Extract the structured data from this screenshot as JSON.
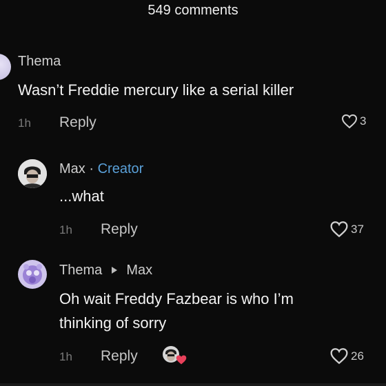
{
  "header": {
    "comment_count": "549 comments"
  },
  "comments": [
    {
      "author": "Thema",
      "text": "Wasn’t Freddie mercury like a serial killer",
      "time": "1h",
      "reply_label": "Reply",
      "likes": "3"
    },
    {
      "author": "Max",
      "separator": "·",
      "badge": "Creator",
      "text": "...what",
      "time": "1h",
      "reply_label": "Reply",
      "likes": "37"
    },
    {
      "author": "Thema",
      "reply_to": "Max",
      "text_line1": "Oh wait Freddy Fazbear is who I’m",
      "text_line2": "thinking of sorry",
      "time": "1h",
      "reply_label": "Reply",
      "likes": "26"
    }
  ],
  "colors": {
    "background": "#0b0b0b",
    "creator_badge": "#5aa0d8",
    "heart_fill": "#e8405a"
  },
  "icons": [
    "heart-outline-icon",
    "creator-liked-heart-icon",
    "reply-arrow-icon"
  ]
}
